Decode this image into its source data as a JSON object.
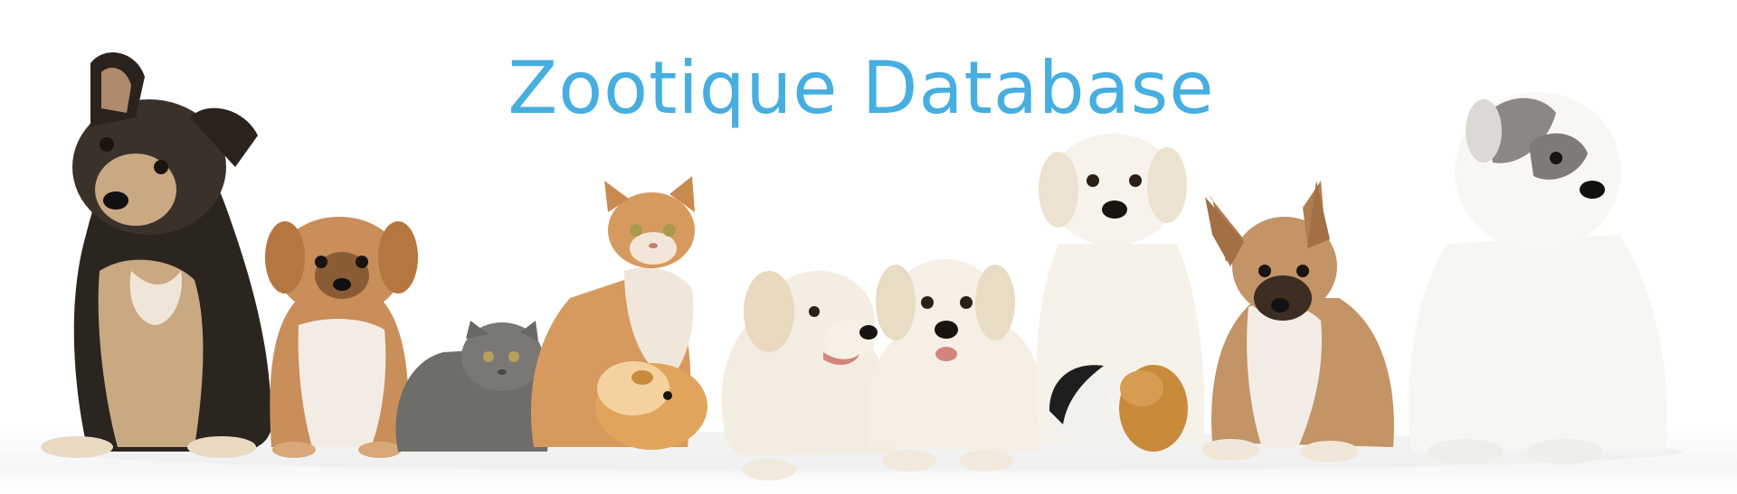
{
  "header": {
    "title": "Zootique Database"
  },
  "colors": {
    "title": "#47aee0",
    "background": "#ffffff"
  },
  "animals": [
    {
      "name": "shepherd-puppy",
      "fur": "#2b2520",
      "accent": "#c9a882"
    },
    {
      "name": "pekingese-dog",
      "fur": "#c98e5a",
      "accent": "#f3ece4"
    },
    {
      "name": "grey-kitten",
      "fur": "#6f6d6a",
      "accent": "#8a8784"
    },
    {
      "name": "ginger-cat",
      "fur": "#d69a5e",
      "accent": "#f1e6da"
    },
    {
      "name": "guinea-pig",
      "fur": "#e0a55a",
      "accent": "#f4d2a0"
    },
    {
      "name": "labrador-puppy-lying",
      "fur": "#f3ece0",
      "accent": "#e8d9bf"
    },
    {
      "name": "labrador-puppy-center",
      "fur": "#f4eee3",
      "accent": "#e9dcc4"
    },
    {
      "name": "labrador-puppy-sitting",
      "fur": "#f6f2ea",
      "accent": "#ece2cf"
    },
    {
      "name": "hamsters",
      "fur": "#1e1e1e",
      "accent": "#c98a3c"
    },
    {
      "name": "mixed-breed-dog",
      "fur": "#c39466",
      "accent": "#f3ede6"
    },
    {
      "name": "white-puppy",
      "fur": "#f7f6f3",
      "accent": "#7d7a77"
    }
  ]
}
